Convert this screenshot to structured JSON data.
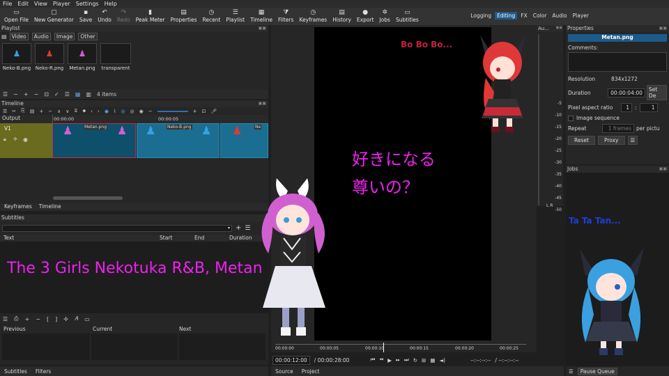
{
  "menu": [
    "File",
    "Edit",
    "View",
    "Player",
    "Settings",
    "Help"
  ],
  "toolbar": [
    {
      "label": "Open File",
      "icon": "folder-icon",
      "glyph": "▭"
    },
    {
      "label": "New Generator",
      "icon": "generator-icon",
      "glyph": "▢"
    },
    {
      "label": "Save",
      "icon": "save-icon",
      "glyph": "▪"
    },
    {
      "label": "Undo",
      "icon": "undo-icon",
      "glyph": "↶"
    },
    {
      "label": "Redo",
      "icon": "redo-icon",
      "glyph": "↷"
    },
    {
      "label": "Peak Meter",
      "icon": "peak-meter-icon",
      "glyph": "▮"
    },
    {
      "label": "Properties",
      "icon": "properties-icon",
      "glyph": "▤"
    },
    {
      "label": "Recent",
      "icon": "recent-icon",
      "glyph": "◷"
    },
    {
      "label": "Playlist",
      "icon": "playlist-icon",
      "glyph": "☰"
    },
    {
      "label": "Timeline",
      "icon": "timeline-icon",
      "glyph": "▦"
    },
    {
      "label": "Filters",
      "icon": "filters-icon",
      "glyph": "⧩"
    },
    {
      "label": "Keyframes",
      "icon": "keyframes-icon",
      "glyph": "◷"
    },
    {
      "label": "History",
      "icon": "history-icon",
      "glyph": "▤"
    },
    {
      "label": "Export",
      "icon": "export-icon",
      "glyph": "●"
    },
    {
      "label": "Jobs",
      "icon": "jobs-icon",
      "glyph": "✲"
    },
    {
      "label": "Subtitles",
      "icon": "subtitles-icon",
      "glyph": "▭"
    }
  ],
  "layouts": {
    "logging": "Logging",
    "editing": "Editing",
    "fx": "FX",
    "color": "Color",
    "audio": "Audio",
    "player": "Player"
  },
  "playlist": {
    "title": "Playlist",
    "tabs": [
      "Video",
      "Audio",
      "Image",
      "Other"
    ],
    "items": [
      {
        "label": "Neko-B.png",
        "color": "#3aa0e0"
      },
      {
        "label": "Neko-R.png",
        "color": "#e03838"
      },
      {
        "label": "Metan.png",
        "color": "#d060d0"
      },
      {
        "label": "transparent",
        "color": ""
      }
    ],
    "count": "4 items"
  },
  "timeline": {
    "title": "Timeline",
    "output_label": "Output",
    "track": "V1",
    "ruler": [
      "00:00:00",
      "00:00:05"
    ],
    "clips": [
      {
        "label": "Metan.png"
      },
      {
        "label": "Neko-B.png"
      },
      {
        "label": "Ne"
      }
    ]
  },
  "bottom_tabs_left": {
    "keyframes": "Keyframes",
    "timeline": "Timeline"
  },
  "subtitles": {
    "title": "Subtitles",
    "columns": [
      "Text",
      "Start",
      "End",
      "Duration"
    ],
    "overlay": "The 3 Girls Nekotuka R&B, Metan",
    "prev": "Previous",
    "current": "Current",
    "next": "Next"
  },
  "bottom_tabs": {
    "subtitles": "Subtitles",
    "filters": "Filters"
  },
  "player": {
    "text_top": "Bo Bo Bo...",
    "jp_line1": "好きになる",
    "jp_line2": "尊いの？",
    "text_right": "Ta Ta Tan...",
    "ruler": [
      "00:00:00",
      "00:00:05",
      "00:00:10",
      "00:00:15",
      "00:00:20",
      "00:00:25"
    ],
    "position": "00:00:12:00",
    "duration": "/ 00:00:28:00",
    "in": "--:--:--:--",
    "out": "/ --:--:--:--",
    "tabs": {
      "source": "Source",
      "project": "Project"
    }
  },
  "audio_meter": {
    "title": "Au...",
    "ticks": [
      "-5",
      "-10",
      "-15",
      "-20",
      "-25",
      "-30",
      "-35",
      "-40",
      "-45",
      "-50"
    ],
    "lr": "L R"
  },
  "properties": {
    "title": "Properties",
    "filename": "Metan.png",
    "comments": "Comments:",
    "resolution_label": "Resolution",
    "resolution": "834x1272",
    "duration_label": "Duration",
    "duration": "00:00:04:00",
    "set_default": "Set De",
    "par_label": "Pixel aspect ratio",
    "par_num": "1",
    "par_sep": ":",
    "par_den": "1",
    "sequence": "Image sequence",
    "repeat_label": "Repeat",
    "repeat": "1 frames",
    "per": "per pictu",
    "reset": "Reset",
    "proxy": "Proxy"
  },
  "jobs": {
    "title": "Jobs",
    "pause": "Pause Queue"
  },
  "colors": {
    "pink": "#ee22ee",
    "blue": "#1c3fd8",
    "red": "#c02040",
    "accent": "#1d5a8a"
  }
}
